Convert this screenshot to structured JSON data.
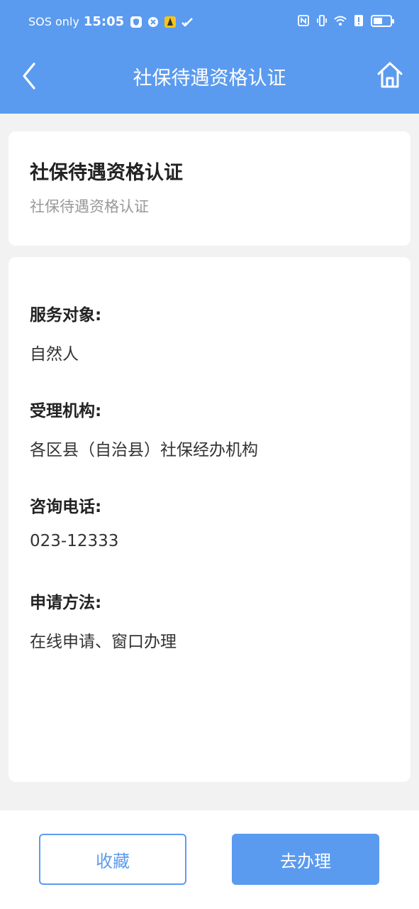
{
  "status_bar": {
    "carrier": "SOS only",
    "time": "15:05",
    "battery_level": 0.55
  },
  "nav": {
    "title": "社保待遇资格认证",
    "back_icon": "chevron-left-icon",
    "home_icon": "home-icon"
  },
  "summary": {
    "title": "社保待遇资格认证",
    "subtitle": "社保待遇资格认证"
  },
  "details": {
    "service_target_label": "服务对象:",
    "service_target_value": "自然人",
    "agency_label": "受理机构:",
    "agency_value": "各区县（自治县）社保经办机构",
    "phone_label": "咨询电话:",
    "phone_value": "023-12333",
    "method_label": "申请方法:",
    "method_value": "在线申请、窗口办理"
  },
  "actions": {
    "favorite_label": "收藏",
    "handle_label": "去办理"
  },
  "colors": {
    "primary": "#5b9bef",
    "background": "#f2f2f2"
  }
}
